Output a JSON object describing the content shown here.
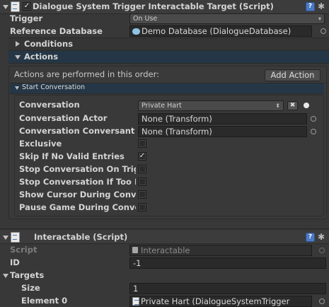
{
  "dst": {
    "title": "Dialogue System Trigger Interactable Target (Script)",
    "trigger": {
      "label": "Trigger",
      "value": "On Use"
    },
    "reference_db": {
      "label": "Reference Database",
      "value": "Demo Database (DialogueDatabase)"
    },
    "conditions_label": "Conditions",
    "actions_label": "Actions",
    "actions_text": "Actions are performed in this order:",
    "add_action_label": "Add Action",
    "start_conversation_label": "Start Conversation",
    "conversation": {
      "label": "Conversation",
      "value": "Private Hart"
    },
    "conversation_actor": {
      "label": "Conversation Actor",
      "value": "None (Transform)"
    },
    "conversation_conversant": {
      "label": "Conversation Conversant",
      "value": "None (Transform)"
    },
    "exclusive": {
      "label": "Exclusive",
      "checked": false
    },
    "skip_if_no_valid": {
      "label": "Skip If No Valid Entries",
      "checked": true
    },
    "stop_on_trigger": {
      "label": "Stop Conversation On Trigger Exit",
      "checked": false
    },
    "stop_if_too_far": {
      "label": "Stop Conversation If Too Far",
      "checked": false
    },
    "show_cursor": {
      "label": "Show Cursor During Conversation",
      "checked": false
    },
    "pause_game": {
      "label": "Pause Game During Conversation",
      "checked": false
    }
  },
  "interactable": {
    "title": "Interactable (Script)",
    "script": {
      "label": "Script",
      "value": "Interactable"
    },
    "id": {
      "label": "ID",
      "value": "-1"
    },
    "targets_label": "Targets",
    "size": {
      "label": "Size",
      "value": "1"
    },
    "element0": {
      "label": "Element 0",
      "value": "Private Hart (DialogueSystemTrigger"
    }
  },
  "icons": [
    "fold-down-icon",
    "script-icon",
    "help-icon",
    "gear-icon",
    "object-icon",
    "circle-picker-icon",
    "checkmark-icon"
  ],
  "colors": {
    "background": "#383838",
    "selected_bar": "#253746",
    "help_icon": "#4b79c5"
  }
}
